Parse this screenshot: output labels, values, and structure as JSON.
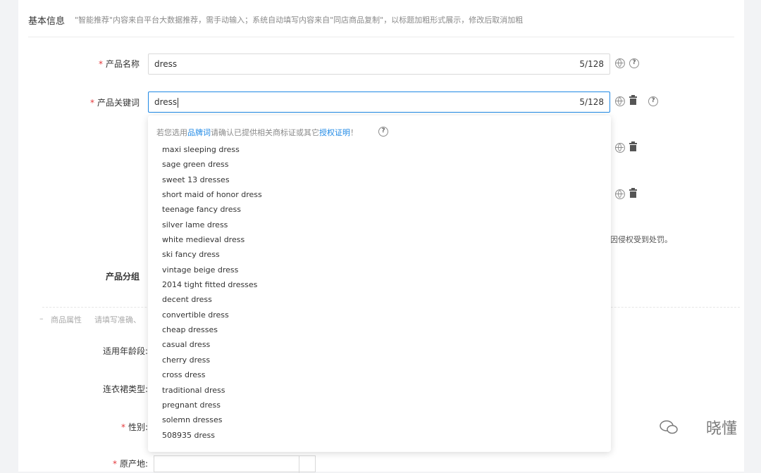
{
  "section": {
    "title": "基本信息",
    "note": "\"智能推荐\"内容来自平台大数据推荐，需手动输入；系统自动填写内容来自\"同店商品复制\"，以标题加粗形式展示，修改后取消加粗"
  },
  "fields": {
    "product_name": {
      "label": "产品名称",
      "value": "dress",
      "count": "5/128"
    },
    "keyword": {
      "label": "产品关键词",
      "value": "dress",
      "count": "5/128"
    },
    "group": {
      "label": "产品分组"
    },
    "attrs": {
      "title": "商品属性",
      "hint": "请填写准确、"
    },
    "age": {
      "label": "适用年龄段:"
    },
    "dress_type": {
      "label": "连衣裙类型:"
    },
    "gender": {
      "label": "性别:"
    },
    "origin": {
      "label": "原产地:"
    }
  },
  "warning_tail": "因侵权受到处罚。",
  "dropdown": {
    "tip_prefix": "若您选用",
    "tip_link1": "品牌词",
    "tip_mid": "请确认已提供相关商标证或其它",
    "tip_link2": "授权证明",
    "tip_suffix": "！",
    "suggestions": [
      "maxi sleeping dress",
      "sage green dress",
      "sweet 13 dresses",
      "short maid of honor dress",
      "teenage fancy dress",
      "silver lame dress",
      "white medieval dress",
      "ski fancy dress",
      "vintage beige dress",
      "2014 tight fitted dresses",
      "decent dress",
      "convertible dress",
      "cheap dresses",
      "casual dress",
      "cherry dress",
      "cross dress",
      "traditional dress",
      "pregnant dress",
      "solemn dresses",
      "508935 dress"
    ]
  },
  "watermark": "晓懂",
  "colors": {
    "accent": "#1e88e5",
    "required": "#e4393c",
    "focus_border": "#1e88e5"
  }
}
